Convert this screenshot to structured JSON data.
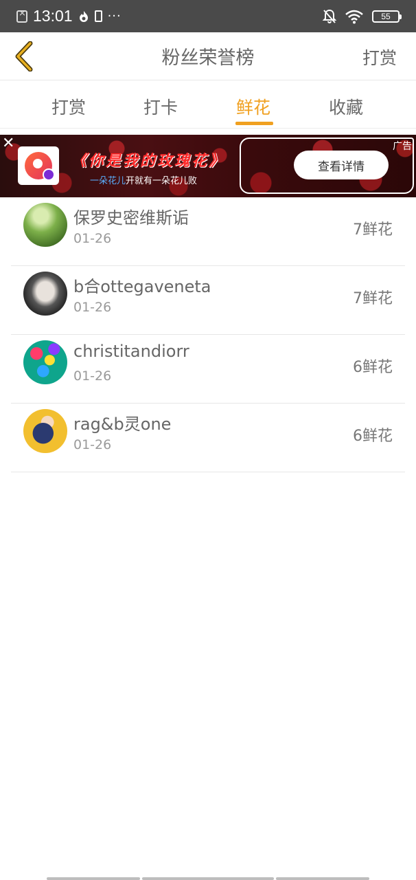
{
  "status_bar": {
    "time": "13:01",
    "extra": "···",
    "battery": "55",
    "icons": [
      "sim-error-icon",
      "flame-icon",
      "phone-icon",
      "mute-bell-icon",
      "wifi-icon",
      "battery-icon"
    ]
  },
  "header": {
    "title": "粉丝荣誉榜",
    "right_action": "打赏",
    "back_icon": "chevron-left-icon"
  },
  "tabs": [
    {
      "label": "打赏",
      "active": false
    },
    {
      "label": "打卡",
      "active": false
    },
    {
      "label": "鲜花",
      "active": true
    },
    {
      "label": "收藏",
      "active": false
    }
  ],
  "ad": {
    "close": "✕",
    "title": "《你是我的玫瑰花》",
    "subtitle_highlight": "一朵花儿",
    "subtitle_rest": "开就有一朵花儿败",
    "tag": "广告",
    "button": "查看详情"
  },
  "fans": [
    {
      "name": "保罗史密维斯诟",
      "date": "01-26",
      "count": "7鲜花"
    },
    {
      "name": "b合ottegaveneta",
      "date": "01-26",
      "count": "7鲜花"
    },
    {
      "name": "christitandiorr",
      "date": "01-26",
      "count": "6鲜花"
    },
    {
      "name": "rag&b灵one",
      "date": "01-26",
      "count": "6鲜花"
    }
  ],
  "colors": {
    "accent": "#f0a020",
    "status_bar_bg": "#4a4a4a",
    "back_icon": "#e8b020"
  }
}
